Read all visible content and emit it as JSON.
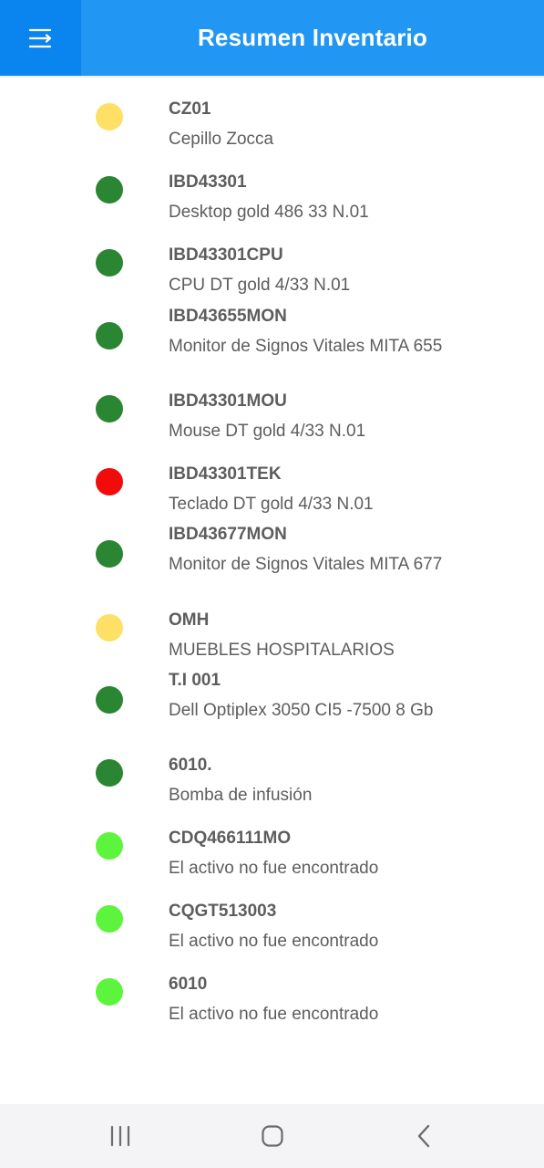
{
  "header": {
    "title": "Resumen Inventario"
  },
  "icons": {
    "menu": "menu-icon",
    "recents": "recents-icon",
    "home": "home-icon",
    "back": "back-icon"
  },
  "colors": {
    "header": "#2196f3",
    "menu_button": "#0a84ef",
    "yellow": "#fde065",
    "dark_green": "#2a8632",
    "red": "#f10b0b",
    "light_green": "#5cf43c"
  },
  "items": [
    {
      "code": "CZ01",
      "description": "Cepillo Zocca",
      "status_color": "#fde065"
    },
    {
      "code": "IBD43301",
      "description": "Desktop gold 486 33 N.01",
      "status_color": "#2a8632"
    },
    {
      "code": "IBD43301CPU",
      "description": "CPU DT gold 4/33 N.01",
      "status_color": "#2a8632"
    },
    {
      "code": "IBD43655MON",
      "description": "Monitor de Signos Vitales MITA 655",
      "status_color": "#2a8632"
    },
    {
      "code": "IBD43301MOU",
      "description": "Mouse DT gold 4/33 N.01",
      "status_color": "#2a8632"
    },
    {
      "code": "IBD43301TEK",
      "description": "Teclado DT gold 4/33 N.01",
      "status_color": "#f10b0b"
    },
    {
      "code": "IBD43677MON",
      "description": "Monitor de Signos Vitales MITA 677",
      "status_color": "#2a8632"
    },
    {
      "code": "OMH",
      "description": "MUEBLES HOSPITALARIOS",
      "status_color": "#fde065"
    },
    {
      "code": "T.I 001",
      "description": "Dell Optiplex 3050 CI5 -7500 8 Gb",
      "status_color": "#2a8632"
    },
    {
      "code": "6010.",
      "description": "Bomba de infusión",
      "status_color": "#2a8632"
    },
    {
      "code": "CDQ466111MO",
      "description": "El activo no fue encontrado",
      "status_color": "#5cf43c"
    },
    {
      "code": "CQGT513003",
      "description": "El activo no fue encontrado",
      "status_color": "#5cf43c"
    },
    {
      "code": "6010",
      "description": "El activo no fue encontrado",
      "status_color": "#5cf43c"
    }
  ]
}
